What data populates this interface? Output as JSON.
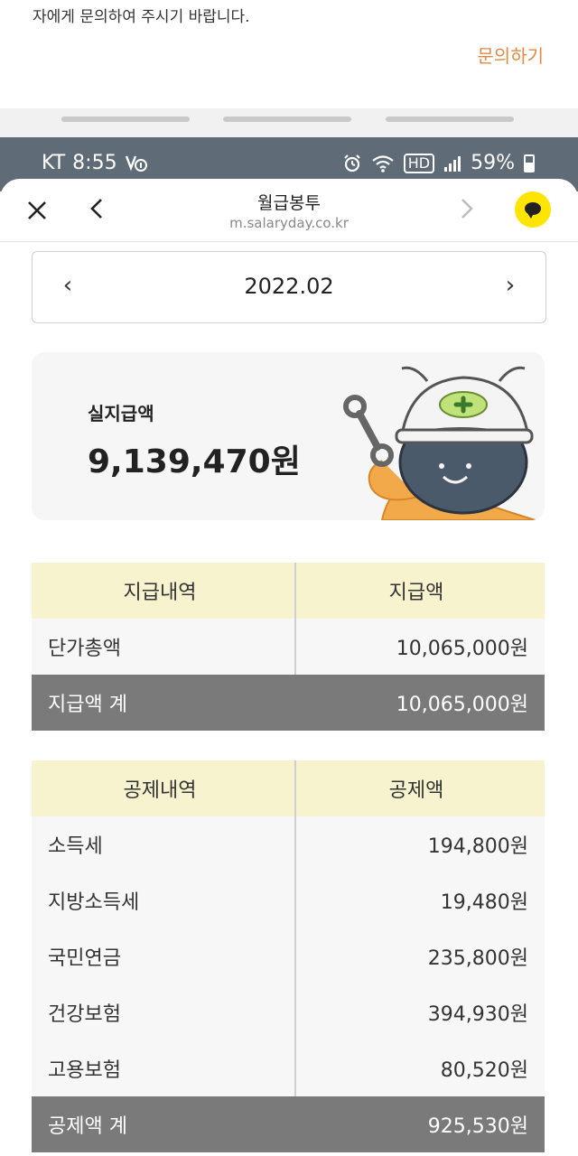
{
  "prev_page": {
    "text": "자에게 문의하여 주시기 바랍니다.",
    "link": "문의하기"
  },
  "status_bar": {
    "carrier": "KT",
    "time": "8:55",
    "hd_label": "HD",
    "battery": "59%"
  },
  "webview": {
    "title": "월급봉투",
    "url": "m.salaryday.co.kr"
  },
  "month_selector": {
    "prev_glyph": "‹",
    "next_glyph": "›",
    "value": "2022.02"
  },
  "net_pay": {
    "label": "실지급액",
    "amount": "9,139,470원"
  },
  "payments": {
    "header": [
      "지급내역",
      "지급액"
    ],
    "rows": [
      {
        "name": "단가총액",
        "amount": "10,065,000원"
      }
    ],
    "total": {
      "name": "지급액 계",
      "amount": "10,065,000원"
    }
  },
  "deductions": {
    "header": [
      "공제내역",
      "공제액"
    ],
    "rows": [
      {
        "name": "소득세",
        "amount": "194,800원"
      },
      {
        "name": "지방소득세",
        "amount": "19,480원"
      },
      {
        "name": "국민연금",
        "amount": "235,800원"
      },
      {
        "name": "건강보험",
        "amount": "394,930원"
      },
      {
        "name": "고용보험",
        "amount": "80,520원"
      }
    ],
    "total": {
      "name": "공제액 계",
      "amount": "925,530원"
    }
  }
}
